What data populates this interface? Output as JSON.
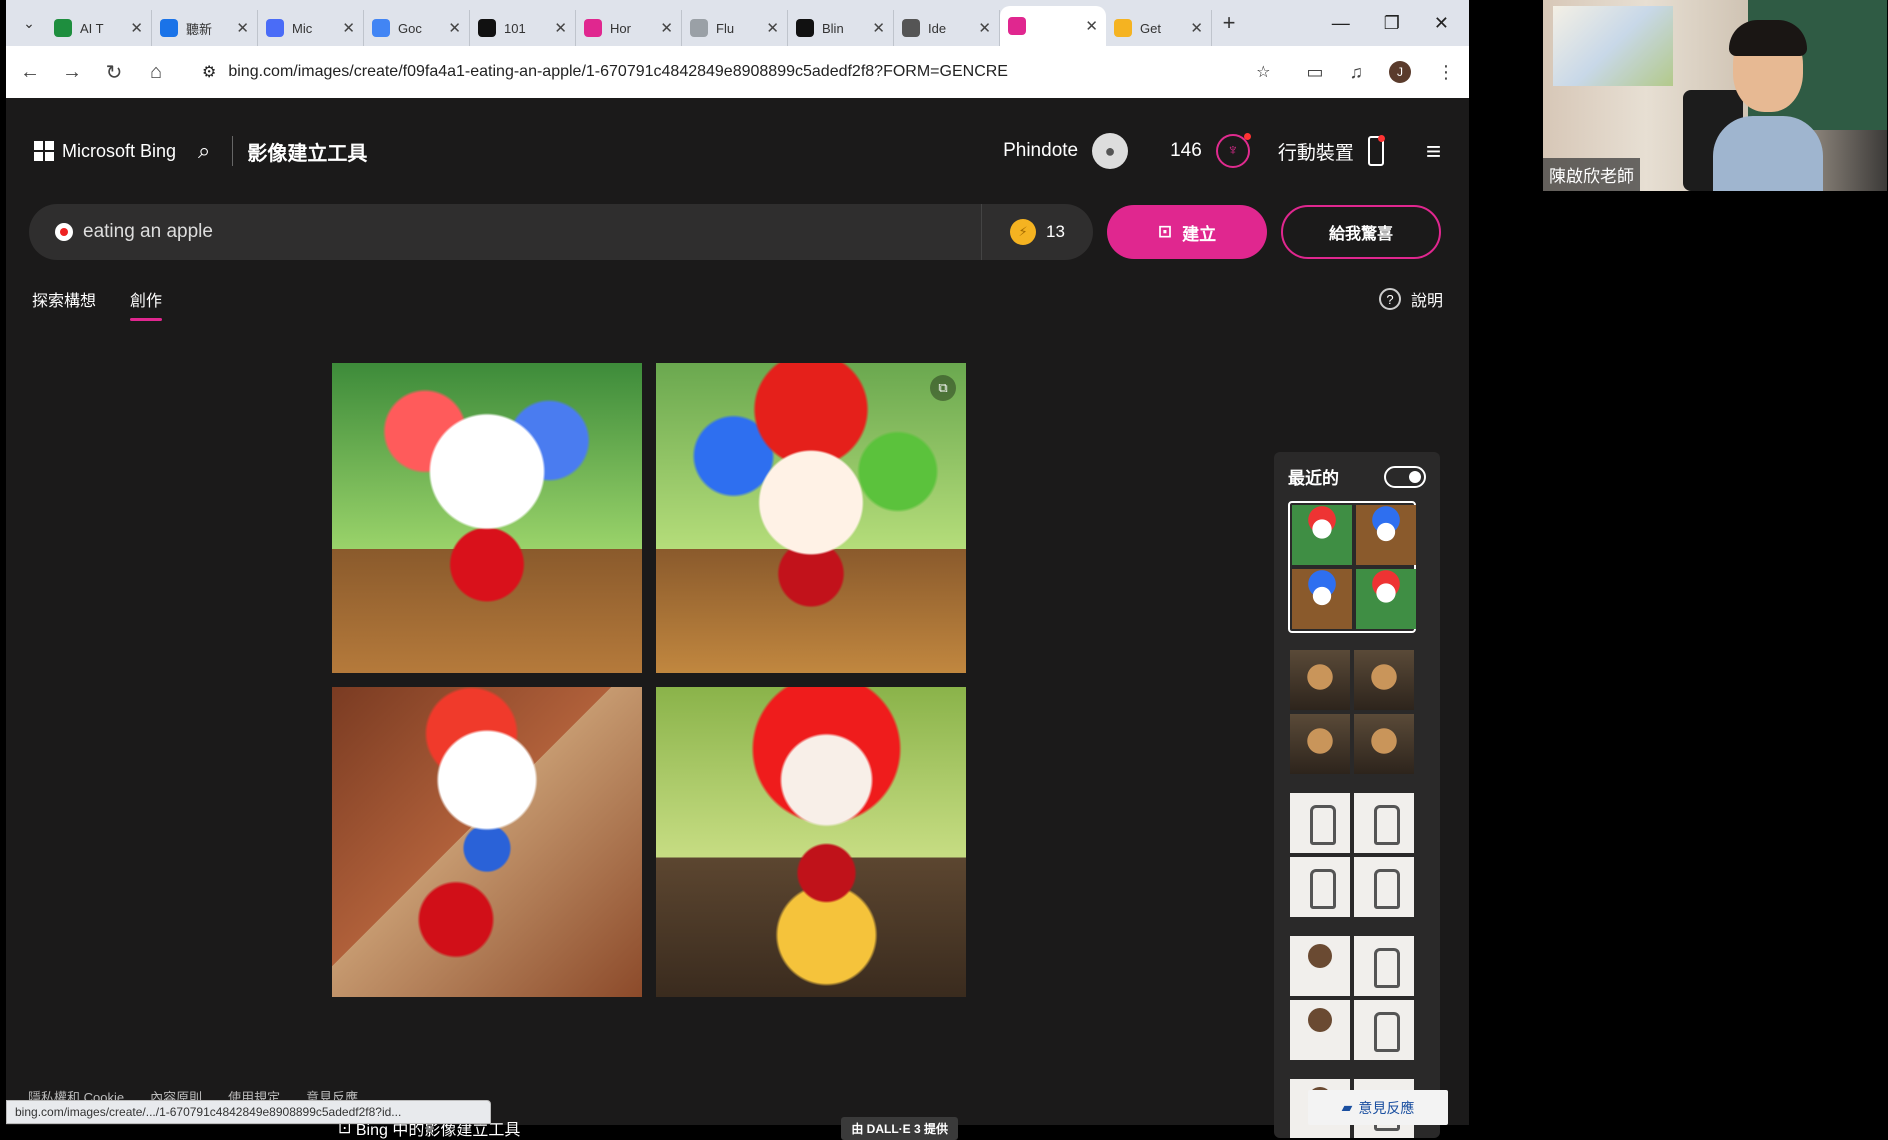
{
  "browser": {
    "tabs": [
      {
        "title": "AI T",
        "fav_color": "#1e8e3e"
      },
      {
        "title": "聽新",
        "fav_color": "#1a73e8"
      },
      {
        "title": "Mic",
        "fav_color": "#4a6cf7"
      },
      {
        "title": "Goc",
        "fav_color": "#4285f4"
      },
      {
        "title": "101",
        "fav_color": "#111111"
      },
      {
        "title": "Hor",
        "fav_color": "#e0278f"
      },
      {
        "title": "Flu",
        "fav_color": "#9aa0a6"
      },
      {
        "title": "Blin",
        "fav_color": "#111111"
      },
      {
        "title": "Ide",
        "fav_color": "#555555"
      },
      {
        "title": "",
        "fav_color": "#e0278f",
        "active": true
      },
      {
        "title": "Get",
        "fav_color": "#f5b321"
      }
    ],
    "url": "bing.com/images/create/f09fa4a1-eating-an-apple/1-670791c4842849e8908899c5adedf2f8?FORM=GENCRE",
    "profile_letter": "J",
    "status_url": "bing.com/images/create/.../1-670791c4842849e8908899c5adedf2f8?id..."
  },
  "header": {
    "brand": "Microsoft Bing",
    "title": "影像建立工具",
    "username": "Phindote",
    "rewards": "146",
    "mobile_label": "行動裝置"
  },
  "search": {
    "prompt": "eating an apple",
    "coins": "13",
    "create_label": "建立",
    "surprise_label": "給我驚喜"
  },
  "nav_tabs": {
    "explore": "探索構想",
    "create": "創作",
    "help": "說明"
  },
  "result": {
    "footer_label": "Bing 中的影像建立工具",
    "credit": "由 DALL·E 3 提供"
  },
  "recent": {
    "title": "最近的"
  },
  "footer": {
    "links": [
      "隱私權和 Cookie",
      "內容原則",
      "使用規定",
      "意見反應"
    ],
    "feedback": "意見反應"
  },
  "webcam": {
    "name": "陳啟欣老師"
  }
}
